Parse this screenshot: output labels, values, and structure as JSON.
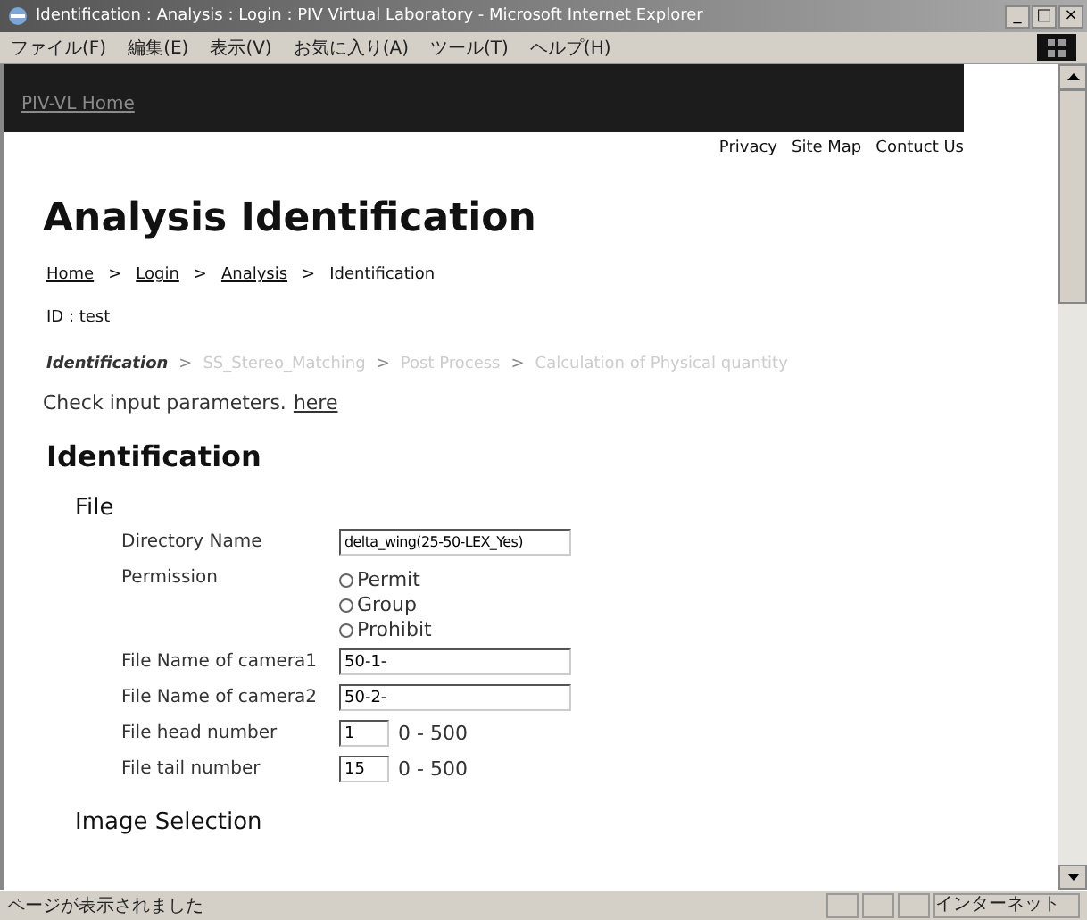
{
  "window": {
    "title": "Identification : Analysis : Login : PIV Virtual Laboratory - Microsoft Internet Explorer",
    "controls": [
      "_",
      "□",
      "×"
    ]
  },
  "menu": [
    "ファイル(F)",
    "編集(E)",
    "表示(V)",
    "お気に入り(A)",
    "ツール(T)",
    "ヘルプ(H)"
  ],
  "header": {
    "home_link": "PIV-VL Home"
  },
  "top_links": [
    "Privacy",
    "Site Map",
    "Contuct Us"
  ],
  "page_title": "Analysis Identification",
  "breadcrumb": [
    {
      "label": "Home",
      "link": true
    },
    {
      "label": "Login",
      "link": true
    },
    {
      "label": "Analysis",
      "link": true
    },
    {
      "label": "Identification",
      "link": false
    }
  ],
  "breadcrumb_separator": ">",
  "id_line": "ID : test",
  "steps": [
    {
      "label": "Identification",
      "selected": true
    },
    {
      "label": "SS_Stereo_Matching",
      "selected": false
    },
    {
      "label": "Post Process",
      "selected": false
    },
    {
      "label": "Calculation of Physical quantity",
      "selected": false
    }
  ],
  "check_text": "Check input parameters.",
  "check_link": "here",
  "section_title": "Identification",
  "subsection": "File",
  "fields": [
    {
      "kind": "text",
      "label": "Directory Name",
      "value": "delta_wing(25-50-LEX_Yes)"
    },
    {
      "kind": "radio",
      "label": "Permission",
      "options": [
        {
          "label": "Permit",
          "selected": false
        },
        {
          "label": "Group",
          "selected": false
        },
        {
          "label": "Prohibit",
          "selected": false
        }
      ]
    },
    {
      "kind": "text",
      "label": "File Name of camera1",
      "value": "50-1-"
    },
    {
      "kind": "text",
      "label": "File Name of camera2",
      "value": "50-2-"
    },
    {
      "kind": "number",
      "label": "File head number",
      "value": "1",
      "range": "0 - 500"
    },
    {
      "kind": "number",
      "label": "File tail number",
      "value": "15",
      "range": "0 - 500"
    }
  ],
  "next_subsection": "Image Selection",
  "status_bar": {
    "text": "ページが表示されました",
    "zone": "インターネット"
  }
}
